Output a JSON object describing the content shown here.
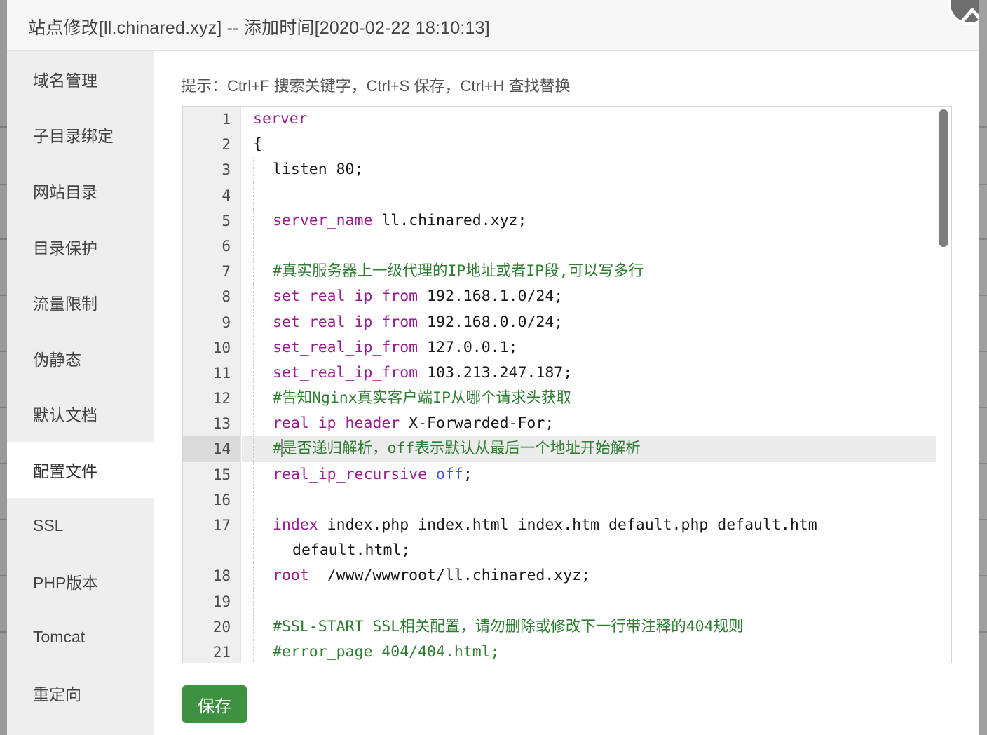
{
  "window": {
    "title": "站点修改[ll.chinared.xyz] -- 添加时间[2020-02-22 18:10:13]",
    "close_icon": "close-circle-icon"
  },
  "sidebar": {
    "items": [
      {
        "label": "域名管理",
        "active": false
      },
      {
        "label": "子目录绑定",
        "active": false
      },
      {
        "label": "网站目录",
        "active": false
      },
      {
        "label": "目录保护",
        "active": false
      },
      {
        "label": "流量限制",
        "active": false
      },
      {
        "label": "伪静态",
        "active": false
      },
      {
        "label": "默认文档",
        "active": false
      },
      {
        "label": "配置文件",
        "active": true
      },
      {
        "label": "SSL",
        "active": false
      },
      {
        "label": "PHP版本",
        "active": false
      },
      {
        "label": "Tomcat",
        "active": false
      },
      {
        "label": "重定向",
        "active": false
      }
    ]
  },
  "content": {
    "hint": "提示：Ctrl+F 搜索关键字，Ctrl+S 保存，Ctrl+H 查找替换",
    "save_label": "保存"
  },
  "editor": {
    "active_line": 14,
    "scroll_thumb_percent": 25,
    "colors": {
      "keyword": "#9b1d8f",
      "comment": "#2f7d32",
      "value": "#3b5bdb",
      "gutter_bg": "#efefef",
      "active_line_bg": "#ebebeb"
    },
    "lines": [
      {
        "n": 1,
        "indent": 0,
        "tokens": [
          {
            "t": "server",
            "c": "kw"
          }
        ]
      },
      {
        "n": 2,
        "indent": 0,
        "tokens": [
          {
            "t": "{",
            "c": ""
          }
        ]
      },
      {
        "n": 3,
        "indent": 1,
        "tokens": [
          {
            "t": "listen",
            "c": ""
          },
          {
            "t": " 80;",
            "c": ""
          }
        ]
      },
      {
        "n": 4,
        "indent": 1,
        "tokens": []
      },
      {
        "n": 5,
        "indent": 1,
        "tokens": [
          {
            "t": "server_name",
            "c": "kw"
          },
          {
            "t": " ll.chinared.xyz;",
            "c": ""
          }
        ]
      },
      {
        "n": 6,
        "indent": 1,
        "tokens": []
      },
      {
        "n": 7,
        "indent": 1,
        "tokens": [
          {
            "t": "#真实服务器上一级代理的IP地址或者IP段,可以写多行",
            "c": "cmt"
          }
        ]
      },
      {
        "n": 8,
        "indent": 1,
        "tokens": [
          {
            "t": "set_real_ip_from",
            "c": "kw"
          },
          {
            "t": " 192.168.1.0/24;",
            "c": ""
          }
        ]
      },
      {
        "n": 9,
        "indent": 1,
        "tokens": [
          {
            "t": "set_real_ip_from",
            "c": "kw"
          },
          {
            "t": " 192.168.0.0/24;",
            "c": ""
          }
        ]
      },
      {
        "n": 10,
        "indent": 1,
        "tokens": [
          {
            "t": "set_real_ip_from",
            "c": "kw"
          },
          {
            "t": " 127.0.0.1;",
            "c": ""
          }
        ]
      },
      {
        "n": 11,
        "indent": 1,
        "tokens": [
          {
            "t": "set_real_ip_from",
            "c": "kw"
          },
          {
            "t": " 103.213.247.187;",
            "c": ""
          }
        ]
      },
      {
        "n": 12,
        "indent": 1,
        "tokens": [
          {
            "t": "#告知Nginx真实客户端IP从哪个请求头获取",
            "c": "cmt"
          }
        ]
      },
      {
        "n": 13,
        "indent": 1,
        "tokens": [
          {
            "t": "real_ip_header",
            "c": "kw"
          },
          {
            "t": " X-Forwarded-For;",
            "c": ""
          }
        ]
      },
      {
        "n": 14,
        "indent": 1,
        "active": true,
        "cursor_after": 1,
        "tokens": [
          {
            "t": "#",
            "c": "cmt"
          },
          {
            "t": "是否递归解析，off表示默认从最后一个地址开始解析",
            "c": "cmt"
          }
        ]
      },
      {
        "n": 15,
        "indent": 1,
        "tokens": [
          {
            "t": "real_ip_recursive",
            "c": "kw"
          },
          {
            "t": " ",
            "c": ""
          },
          {
            "t": "off",
            "c": "val"
          },
          {
            "t": ";",
            "c": ""
          }
        ]
      },
      {
        "n": 16,
        "indent": 1,
        "tokens": []
      },
      {
        "n": 17,
        "indent": 1,
        "tokens": [
          {
            "t": "index",
            "c": "kw"
          },
          {
            "t": " index.php index.html index.htm default.php default.htm",
            "c": ""
          }
        ]
      },
      {
        "n": null,
        "indent": 2,
        "wrap": true,
        "tokens": [
          {
            "t": "default.html;",
            "c": ""
          }
        ]
      },
      {
        "n": 18,
        "indent": 1,
        "tokens": [
          {
            "t": "root",
            "c": "kw"
          },
          {
            "t": "  /www/wwwroot/ll.chinared.xyz;",
            "c": ""
          }
        ]
      },
      {
        "n": 19,
        "indent": 1,
        "tokens": []
      },
      {
        "n": 20,
        "indent": 1,
        "tokens": [
          {
            "t": "#SSL-START SSL相关配置，请勿删除或修改下一行带注释的404规则",
            "c": "cmt"
          }
        ]
      },
      {
        "n": 21,
        "indent": 1,
        "tokens": [
          {
            "t": "#error_page 404/404.html;",
            "c": "cmt"
          }
        ]
      }
    ]
  }
}
